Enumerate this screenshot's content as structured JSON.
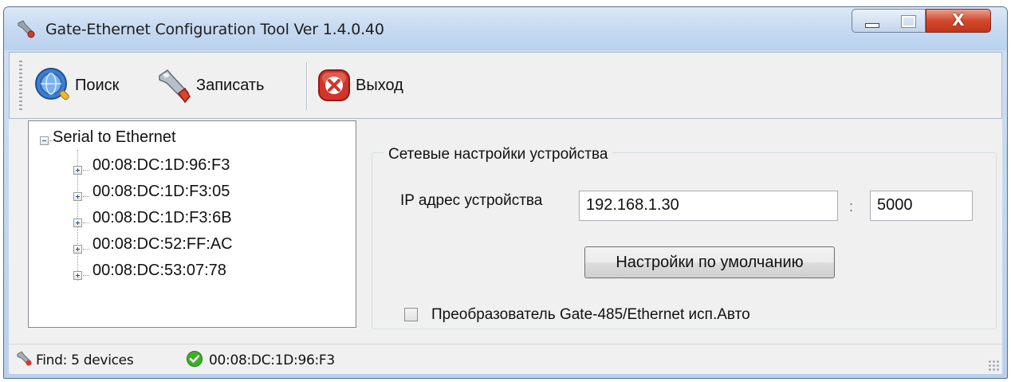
{
  "window": {
    "title": "Gate-Ethernet Configuration Tool Ver 1.4.0.40",
    "controls": {
      "close_glyph": "X"
    }
  },
  "toolbar": {
    "buttons": [
      {
        "label": "Поиск",
        "icon": "search-globe-icon"
      },
      {
        "label": "Записать",
        "icon": "wrench-icon"
      },
      {
        "label": "Выход",
        "icon": "exit-icon"
      }
    ]
  },
  "tree": {
    "root": "Serial to Ethernet",
    "items": [
      "00:08:DC:1D:96:F3",
      "00:08:DC:1D:F3:05",
      "00:08:DC:1D:F3:6B",
      "00:08:DC:52:FF:AC",
      "00:08:DC:53:07:78"
    ]
  },
  "settings": {
    "group_title": "Сетевые настройки устройства",
    "ip_label": "IP адрес устройства",
    "ip_value": "192.168.1.30",
    "separator": ":",
    "port_value": "5000",
    "default_button": "Настройки по умолчанию",
    "checkbox_label": "Преобразователь Gate-485/Ethernet исп.Авто",
    "checkbox_checked": false
  },
  "status": {
    "find_text": "Find: 5 devices",
    "selected_device": "00:08:DC:1D:96:F3"
  },
  "colors": {
    "titlebar": "#c6daf1",
    "close_button": "#c0361b",
    "ok_green": "#3fae2a",
    "exit_red": "#d2342a"
  }
}
